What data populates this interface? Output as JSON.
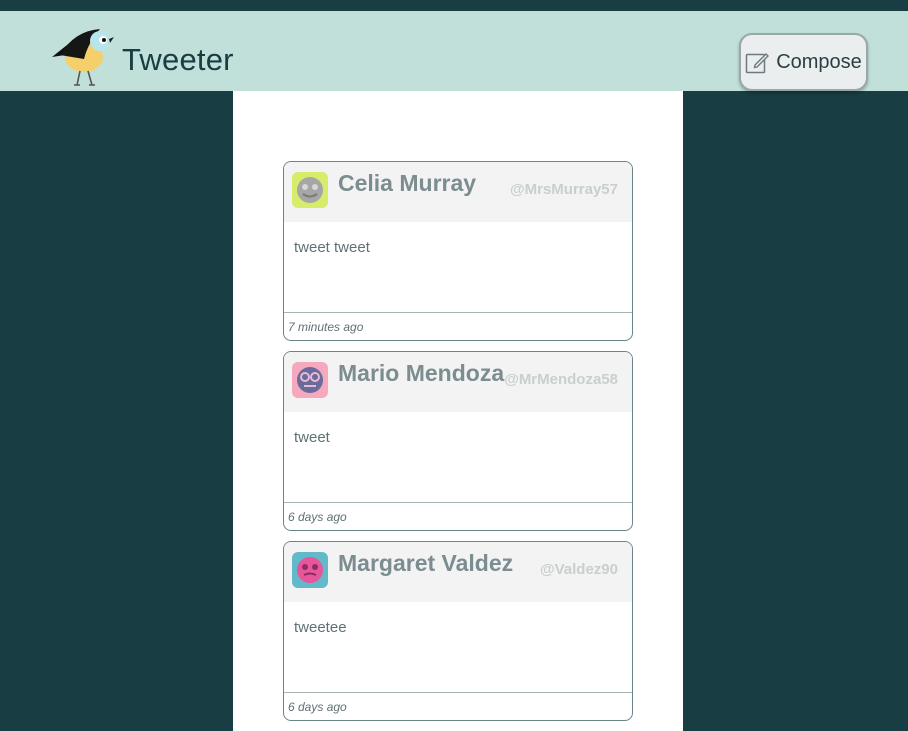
{
  "app": {
    "title": "Tweeter",
    "logo_icon": "bird-logo-icon"
  },
  "nav": {
    "compose_label": "Compose",
    "compose_icon": "compose-icon"
  },
  "colors": {
    "page_background": "#183d42",
    "navbar_background": "#c2e0da",
    "card_border": "#6a8588",
    "name_text": "#7b8d90",
    "handle_text": "#c9cfcf"
  },
  "tweets": [
    {
      "name": "Celia Murray",
      "handle": "@MrsMurray57",
      "text": "tweet tweet",
      "time": "7 minutes ago",
      "avatar_icon": "robot-avatar-icon"
    },
    {
      "name": "Mario Mendoza",
      "handle": "@MrMendoza58",
      "text": "tweet",
      "time": "6 days ago",
      "avatar_icon": "robot-avatar-icon"
    },
    {
      "name": "Margaret Valdez",
      "handle": "@Valdez90",
      "text": "tweetee",
      "time": "6 days ago",
      "avatar_icon": "robot-avatar-icon"
    }
  ]
}
